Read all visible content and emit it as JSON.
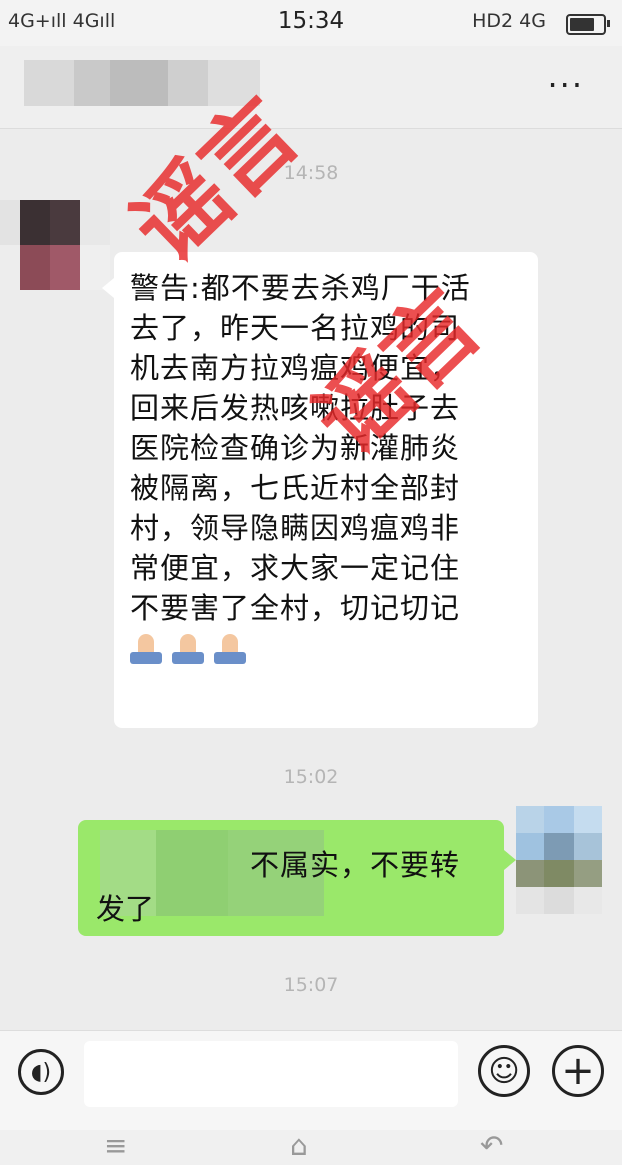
{
  "status_bar": {
    "signal": "4G+ıll 4Gıll",
    "time": "15:34",
    "network": "HD2 4G"
  },
  "header": {
    "more_icon": "more-icon"
  },
  "messages": {
    "ts1": "14:58",
    "incoming_lines": [
      "警告:都不要去杀鸡厂干活",
      "去了，昨天一名拉鸡的司",
      "机去南方拉鸡瘟鸡便宜，",
      "回来后发热咳嗽拉肚子去",
      "医院检查确诊为新灌肺炎",
      "被隔离，七氏近村全部封",
      "村，领导隐瞒因鸡瘟鸡非",
      "常便宜，求大家一定记住",
      "不要害了全村，切记切记"
    ],
    "ts2": "15:02",
    "outgoing_line1": "不属实，不要转",
    "outgoing_line2": "发了",
    "ts3": "15:07"
  },
  "stamp": {
    "text1": "谣言",
    "text2": "谣言",
    "color": "#e8292a"
  },
  "input_bar": {
    "voice_icon": "voice-icon",
    "emoji_icon": "emoji-icon",
    "plus_icon": "plus-icon"
  },
  "nav_bar": {
    "icons": [
      "menu-icon",
      "home-icon",
      "back-icon"
    ]
  }
}
